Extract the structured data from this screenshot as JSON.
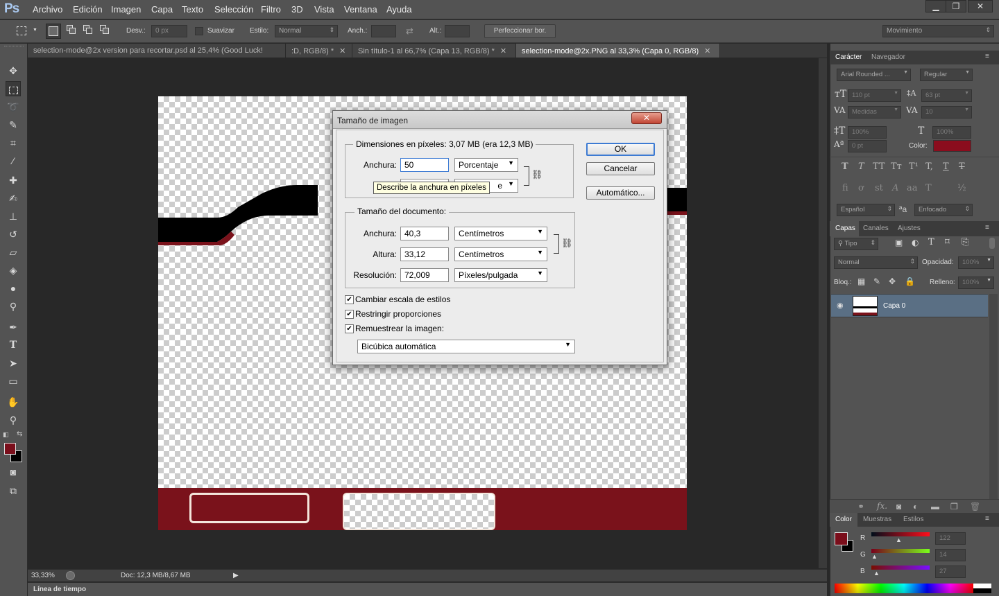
{
  "app": {
    "logo": "Ps"
  },
  "menu": [
    "Archivo",
    "Edición",
    "Imagen",
    "Capa",
    "Texto",
    "Selección",
    "Filtro",
    "3D",
    "Vista",
    "Ventana",
    "Ayuda"
  ],
  "window_controls": {
    "minimize": "▁",
    "restore": "❐",
    "close": "✕"
  },
  "options": {
    "feather_label": "Desv.:",
    "feather_value": "0 px",
    "antialias_label": "Suavizar",
    "style_label": "Estilo:",
    "style_value": "Normal",
    "width_label": "Anch.:",
    "height_label": "Alt.:",
    "refine_button": "Perfeccionar bor.",
    "workspace": "Movimiento"
  },
  "tabs": [
    {
      "label": "selection-mode@2x version para recortar.psd al 25,4% (Good Luck!"
    },
    {
      "label": ":D, RGB/8) *",
      "close": "✕"
    },
    {
      "label": "Sin título-1 al 66,7% (Capa 13, RGB/8) *",
      "close": "✕"
    },
    {
      "label": "selection-mode@2x.PNG al 33,3% (Capa 0, RGB/8)",
      "close": "✕"
    }
  ],
  "status": {
    "zoom": "33,33%",
    "doc": "Doc: 12,3 MB/8,67 MB",
    "arrow": "▶"
  },
  "timeline": {
    "label": "Línea de tiempo"
  },
  "character_panel": {
    "tabs": [
      "Carácter",
      "Navegador"
    ],
    "font_family": "Arial Rounded ...",
    "font_style": "Regular",
    "size": "110 pt",
    "leading": "63 pt",
    "kerning": "Medidas",
    "tracking": "10",
    "vscale": "100%",
    "hscale": "100%",
    "baseline": "0 pt",
    "color_label": "Color:",
    "text_color": "#8b0d1d",
    "styles": [
      "T",
      "T",
      "TT",
      "Tт",
      "T¹",
      "T,",
      "T",
      "T"
    ],
    "opentype": [
      "fi",
      "ơ",
      "st",
      "A",
      "aa",
      "T",
      "½"
    ],
    "language": "Español",
    "aa_icon": "ªa",
    "antialias": "Enfocado"
  },
  "layers_panel": {
    "tabs": [
      "Capas",
      "Canales",
      "Ajustes"
    ],
    "filter": "Tipo",
    "blend_mode": "Normal",
    "opacity_label": "Opacidad:",
    "opacity": "100%",
    "lock_label": "Bloq.:",
    "fill_label": "Relleno:",
    "fill": "100%",
    "layers": [
      {
        "name": "Capa 0",
        "visible_icon": "👁"
      }
    ]
  },
  "color_panel": {
    "tabs": [
      "Color",
      "Muestras",
      "Estilos"
    ],
    "r_label": "R",
    "g_label": "G",
    "b_label": "B",
    "r": "122",
    "g": "14",
    "b": "27",
    "fg_color": "#7a0e1b"
  },
  "dialog": {
    "title": "Tamaño de imagen",
    "close": "✕",
    "pixel_dims_label": "Dimensiones en píxeles: 3,07 MB (era 12,3 MB)",
    "pixel_width_label": "Anchura:",
    "pixel_width": "50",
    "pixel_width_unit": "Porcentaje",
    "pixel_height_unit": "e",
    "doc_size_label": "Tamaño del documento:",
    "doc_width_label": "Anchura:",
    "doc_width": "40,3",
    "doc_width_unit": "Centímetros",
    "doc_height_label": "Altura:",
    "doc_height": "33,12",
    "doc_height_unit": "Centímetros",
    "resolution_label": "Resolución:",
    "resolution": "72,009",
    "resolution_unit": "Píxeles/pulgada",
    "scale_styles": "Cambiar escala de estilos",
    "constrain": "Restringir proporciones",
    "resample": "Remuestrear la imagen:",
    "resample_method": "Bicúbica automática",
    "ok": "OK",
    "cancel": "Cancelar",
    "auto": "Automático...",
    "tooltip": "Describe la anchura en píxeles"
  }
}
